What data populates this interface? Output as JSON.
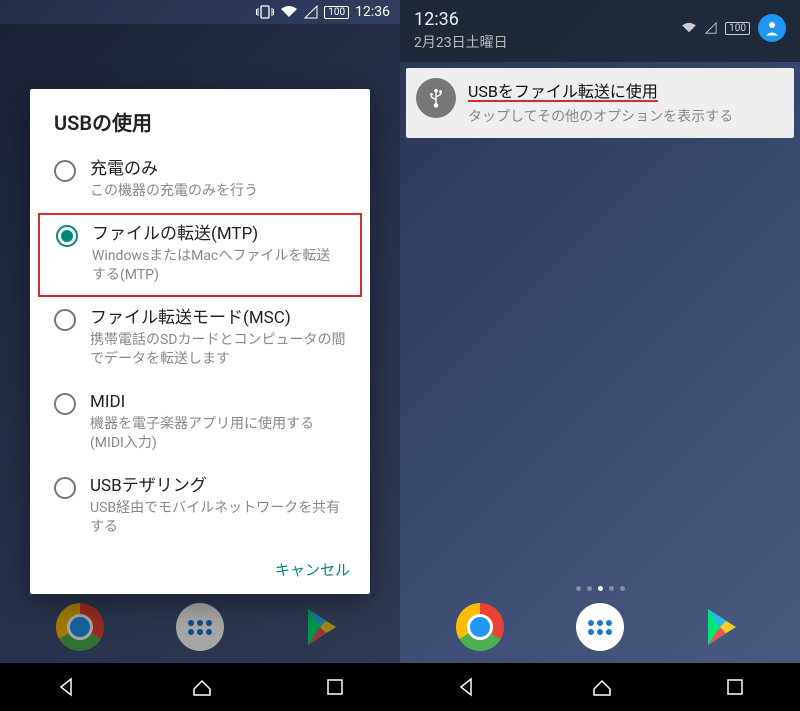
{
  "left": {
    "status": {
      "battery": "100",
      "time": "12:36"
    },
    "dialog": {
      "title": "USBの使用",
      "options": [
        {
          "title": "充電のみ",
          "subtitle": "この機器の充電のみを行う",
          "selected": false,
          "highlight": false
        },
        {
          "title": "ファイルの転送(MTP)",
          "subtitle": "WindowsまたはMacへファイルを転送する(MTP)",
          "selected": true,
          "highlight": true
        },
        {
          "title": "ファイル転送モード(MSC)",
          "subtitle": "携帯電話のSDカードとコンピュータの間でデータを転送します",
          "selected": false,
          "highlight": false
        },
        {
          "title": "MIDI",
          "subtitle": "機器を電子楽器アプリ用に使用する(MIDI入力)",
          "selected": false,
          "highlight": false
        },
        {
          "title": "USBテザリング",
          "subtitle": "USB経由でモバイルネットワークを共有する",
          "selected": false,
          "highlight": false
        }
      ],
      "cancel": "キャンセル"
    }
  },
  "right": {
    "shade": {
      "time": "12:36",
      "date": "2月23日土曜日",
      "battery": "100"
    },
    "notification": {
      "title": "USBをファイル転送に使用",
      "subtitle": "タップしてその他のオプションを表示する"
    },
    "pager": {
      "count": 5,
      "active": 2
    }
  }
}
